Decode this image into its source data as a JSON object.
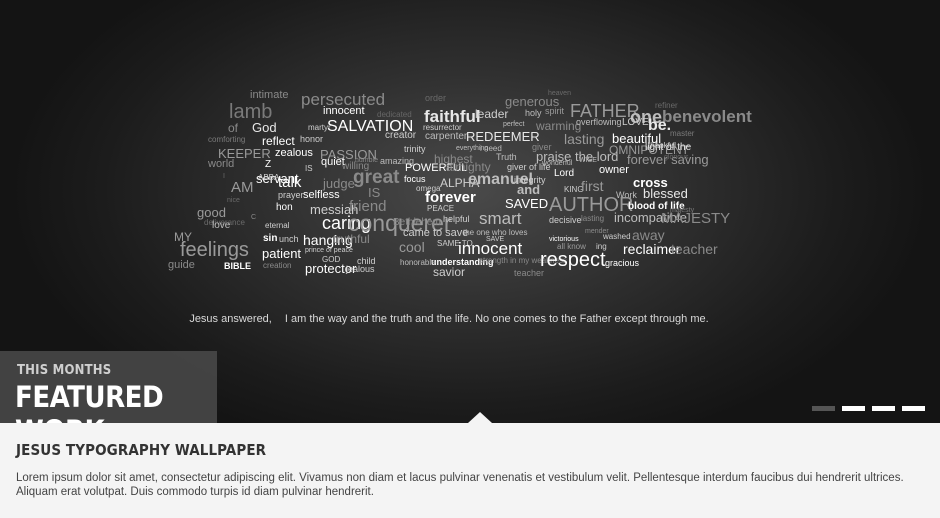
{
  "hero": {
    "quote": "Jesus answered, I am the way and the truth and the life. No one comes to the Father except through me.",
    "quote_part1": "Jesus answered,",
    "quote_part2": "I am the way and the truth and the life. No one comes to the Father except through me.",
    "words": [
      "intimate",
      "persecuted",
      "order",
      "generous",
      "heaven",
      "refiner",
      "lamb",
      "innocent",
      "dedicated",
      "faithful",
      "leader",
      "holy",
      "spirit",
      "FATHER",
      "one",
      "benevolent",
      "of",
      "God",
      "martyr",
      "SALVATION",
      "resurrector",
      "perfect",
      "warming",
      "overflowing",
      "LOVE",
      "be.",
      "master",
      "comforting",
      "reflect",
      "honor",
      "creator",
      "carpenter",
      "REDEEMER",
      "lasting",
      "beautiful",
      "thankful",
      "KEEPER",
      "zealous",
      "PASSION",
      "trinity",
      "everything",
      "i need",
      "giver",
      "OMNIPOTENT",
      "light of the",
      "world",
      "Z",
      "quiet",
      "humble",
      "amazing",
      "highest",
      "Truth",
      "praise the lord",
      "WISE",
      "forever saving",
      "glorious",
      "I",
      "servant",
      "IS",
      "willing",
      "POWERFUL",
      "almighty",
      "giver of life",
      "wonderful",
      "owner",
      "ABBA",
      "great",
      "focus",
      "ALPHA",
      "emanuel",
      "integrity",
      "Lord",
      "cross",
      "AM",
      "talk",
      "judge",
      "IS",
      "omega",
      "and",
      "KING",
      "first",
      "nice",
      "prayer",
      "selfless",
      "forever",
      "Work",
      "blessed",
      "good",
      "hon",
      "messiah",
      "friend",
      "PEACE",
      "SAVED",
      "AUTHOR",
      "blood of life",
      "majesty",
      "deliverance",
      "C",
      "caring",
      "conquerer",
      "helpful",
      "smart",
      "decisive",
      "lasting",
      "incompatible",
      "MAJESTY",
      "love",
      "eternal",
      "Bethlehem",
      "came to save",
      "the one who loves",
      "mender",
      "MY",
      "sin",
      "unch",
      "hanging",
      "truthful",
      "cool",
      "SAME TO",
      "SAVE",
      "victorious",
      "washed",
      "away",
      "feelings",
      "patient",
      "prince of peace",
      "innocent",
      "all know",
      "ing",
      "reclaimer",
      "teacher",
      "guide",
      "BIBLE",
      "creation",
      "protector",
      "GOD",
      "child",
      "understanding",
      "savior",
      "strength in my weakness",
      "respect",
      "gracious",
      "jealous",
      "honorable",
      "teacher"
    ]
  },
  "featured": {
    "subtitle": "THIS MONTHS",
    "title": "FEATURED WORK"
  },
  "slider": {
    "dots": [
      {
        "label": "slide 1",
        "active": true
      },
      {
        "label": "slide 2",
        "active": false
      },
      {
        "label": "slide 3",
        "active": false
      },
      {
        "label": "slide 4",
        "active": false
      }
    ]
  },
  "caption": {
    "title": "JESUS TYPOGRAPHY WALLPAPER",
    "body": "Lorem ipsum dolor sit amet, consectetur adipiscing elit. Vivamus non diam et lacus pulvinar venenatis et vestibulum velit. Pellentesque interdum faucibus dui hendrerit ultrices. Aliquam erat volutpat. Duis commodo turpis id diam pulvinar hendrerit."
  }
}
